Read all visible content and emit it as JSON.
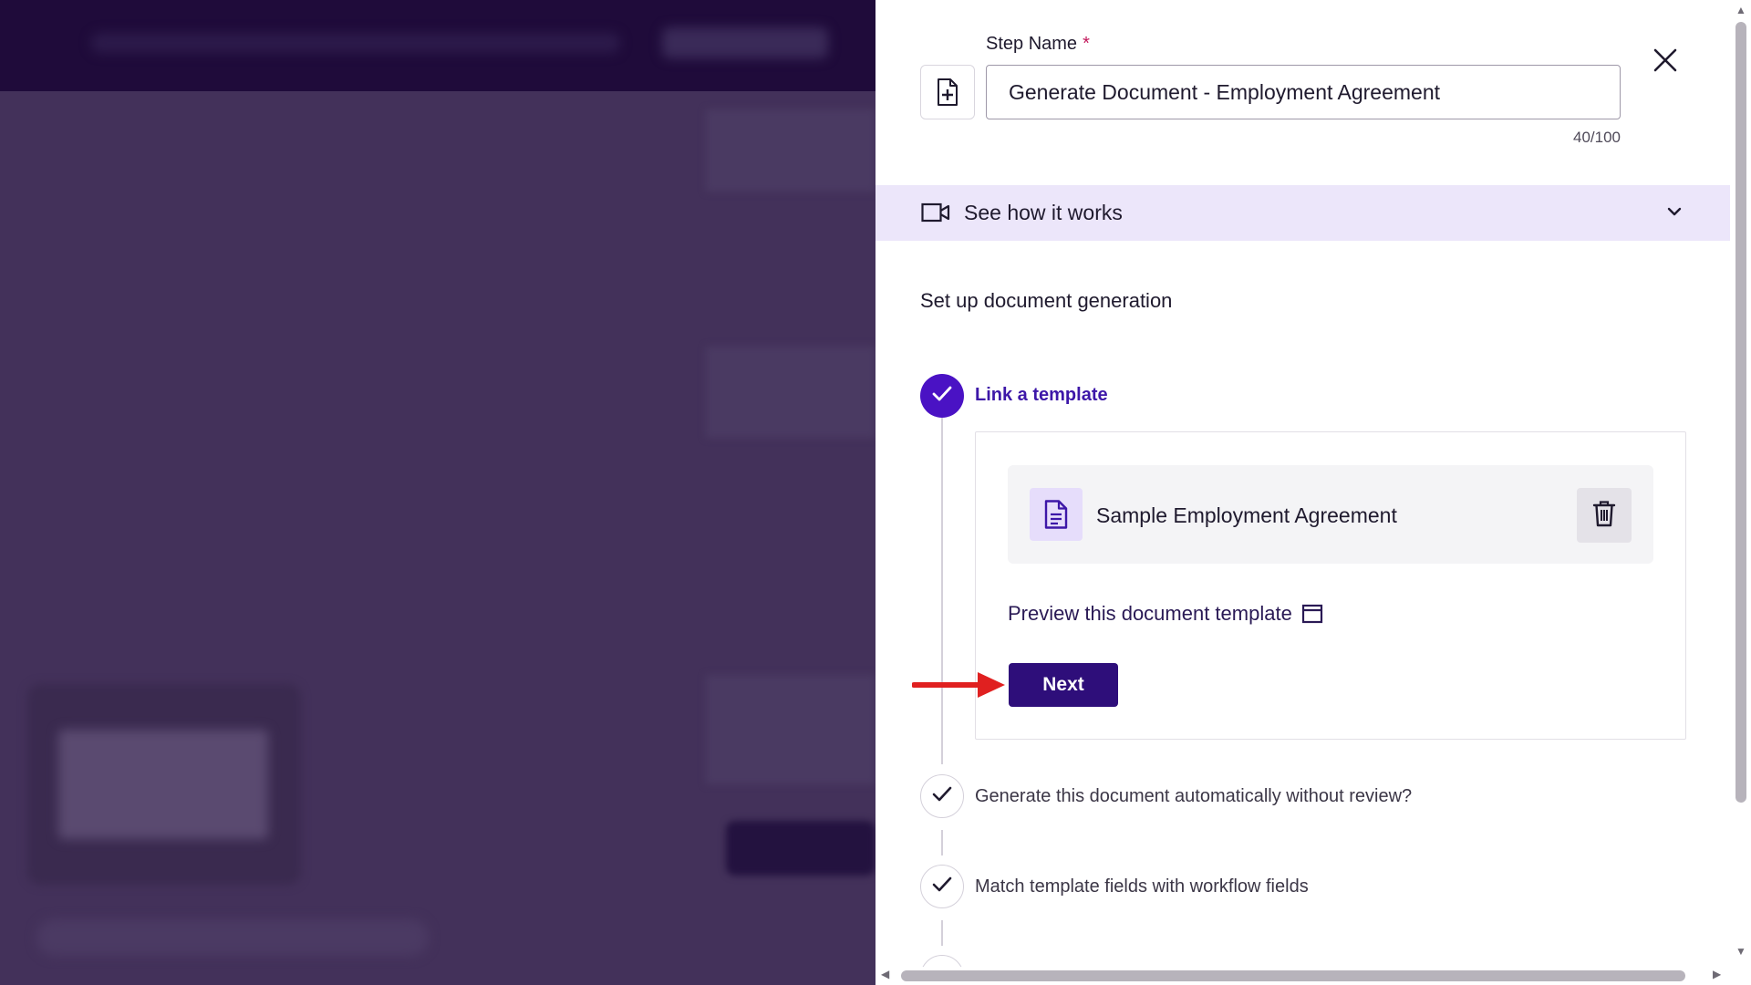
{
  "panel": {
    "step_name_label": "Step Name",
    "required_mark": "*",
    "step_name_value": "Generate Document - Employment Agreement",
    "char_count": "40/100",
    "close_icon": "close-icon",
    "doc_icon": "document-plus-icon"
  },
  "how_it_works": {
    "label": "See how it works",
    "icon": "video-camera-icon",
    "expand_icon": "chevron-down-icon"
  },
  "setup": {
    "title": "Set up document generation",
    "steps": [
      {
        "label": "Link a template",
        "status": "active"
      },
      {
        "label": "Generate this document automatically without review?",
        "status": "complete"
      },
      {
        "label": "Match template fields with workflow fields",
        "status": "complete"
      }
    ]
  },
  "template": {
    "name": "Sample Employment Agreement",
    "icon": "document-icon",
    "delete_icon": "trash-icon",
    "preview_link": "Preview this document template",
    "preview_icon": "open-window-icon",
    "next_button": "Next"
  },
  "colors": {
    "primary": "#2e0e7a",
    "accent": "#4a12c4",
    "banner": "#ece6fa",
    "annotation_arrow": "#e02020",
    "overlay": "#43315a"
  }
}
